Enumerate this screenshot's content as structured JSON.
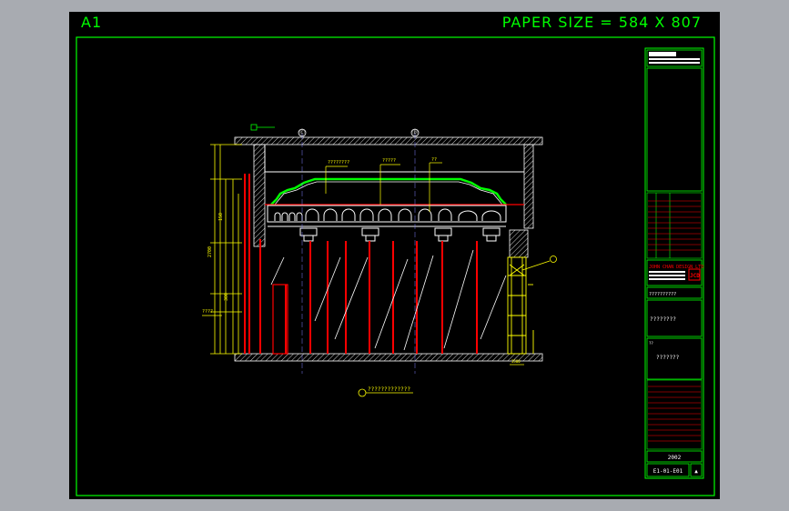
{
  "sheet": {
    "size_label": "A1",
    "paper_size_label": "PAPER SIZE = 584 X 807"
  },
  "drawing": {
    "grid_bubbles": [
      "Ⓒ",
      "Ⓓ"
    ],
    "leader_notes": [
      "????????",
      "?????",
      "??"
    ],
    "left_dim_label": "????",
    "caption": "?????????????",
    "dimension_texts": [
      "150",
      "2700",
      "300",
      "3500"
    ]
  },
  "title_block": {
    "company": "JOHN CHAN DESIGN LTD",
    "project_line": "??????????",
    "drawing_title": "????????",
    "sub_label": "??",
    "sub_value": "???????",
    "year": "2002",
    "drawing_no": "E1-01-E01",
    "rev_mark": "▲"
  },
  "colors": {
    "background": "#000000",
    "border": "#00ff00",
    "wall": "#ffffff",
    "column": "#ff0000",
    "detail": "#ffff00",
    "glass": "#ffffff",
    "title_red": "#ff0000"
  }
}
